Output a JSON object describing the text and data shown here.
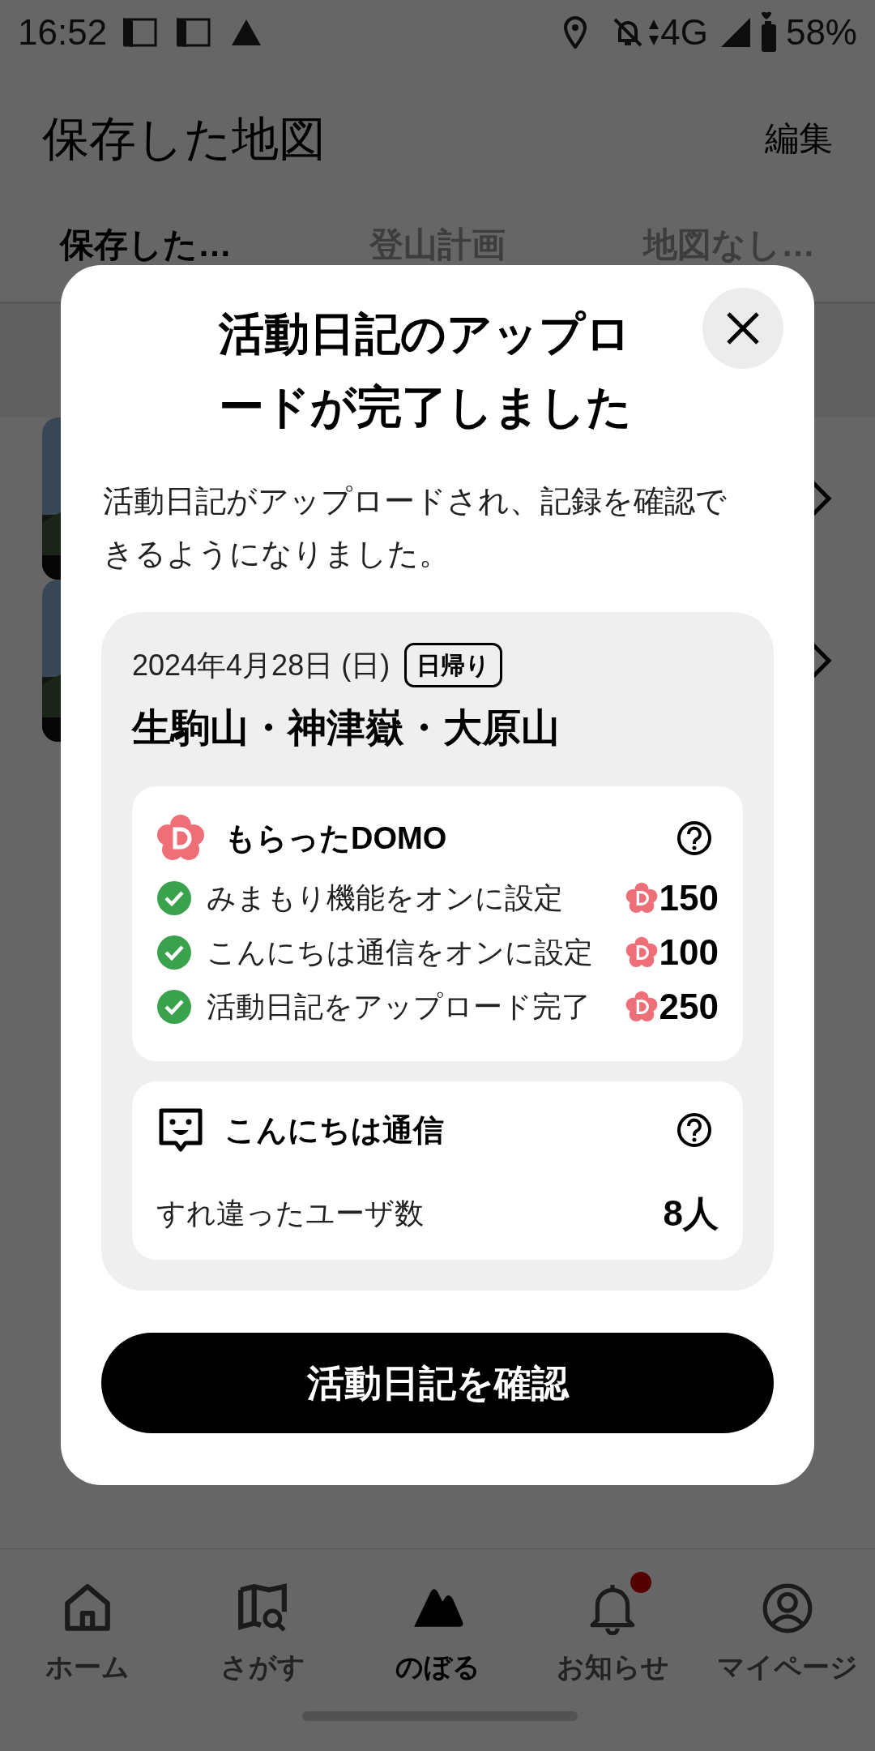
{
  "status_bar": {
    "time": "16:52",
    "network": "4G",
    "battery": "58%"
  },
  "header": {
    "title": "保存した地図",
    "action": "編集"
  },
  "tabs": [
    {
      "label": "保存した…",
      "selected": true
    },
    {
      "label": "登山計画",
      "selected": false
    },
    {
      "label": "地図なし…",
      "selected": false
    }
  ],
  "dialog": {
    "title": "活動日記のアップロードが完了しました",
    "message": "活動日記がアップロードされ、記録を確認できるようになりました。",
    "record": {
      "date": "2024年4月28日 (日)",
      "badge": "日帰り",
      "name": "生駒山・神津嶽・大原山",
      "domo": {
        "title": "もらったDOMO",
        "items": [
          {
            "label": "みまもり機能をオンに設定",
            "points": "150",
            "done": true
          },
          {
            "label": "こんにちは通信をオンに設定",
            "points": "100",
            "done": true
          },
          {
            "label": "活動日記をアップロード完了",
            "points": "250",
            "done": true
          }
        ]
      },
      "encounter": {
        "title": "こんにちは通信",
        "label": "すれ違ったユーザ数",
        "value": "8人"
      }
    },
    "button": "活動日記を確認"
  },
  "nav": [
    {
      "label": "ホーム",
      "kind": "home",
      "selected": false,
      "badge": false
    },
    {
      "label": "さがす",
      "kind": "search",
      "selected": false,
      "badge": false
    },
    {
      "label": "のぼる",
      "kind": "climb",
      "selected": true,
      "badge": false
    },
    {
      "label": "お知らせ",
      "kind": "bell",
      "selected": false,
      "badge": true
    },
    {
      "label": "マイページ",
      "kind": "profile",
      "selected": false,
      "badge": false
    }
  ]
}
